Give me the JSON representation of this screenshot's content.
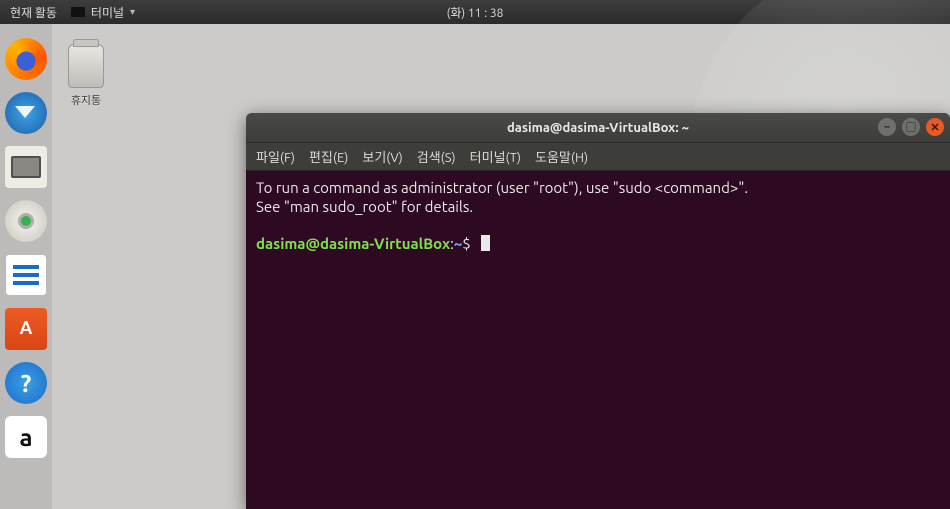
{
  "top_panel": {
    "activities": "현재 활동",
    "app_name": "터미널",
    "clock": "(화) 11 : 38"
  },
  "desktop": {
    "trash_label": "휴지통"
  },
  "terminal": {
    "title": "dasima@dasima-VirtualBox: ~",
    "menu": {
      "file": "파일(F)",
      "edit": "편집(E)",
      "view": "보기(V)",
      "search": "검색(S)",
      "terminal": "터미널(T)",
      "help": "도움말(H)"
    },
    "message_line1": "To run a command as administrator (user \"root\"), use \"sudo <command>\".",
    "message_line2": "See \"man sudo_root\" for details.",
    "ps1_user": "dasima@dasima-VirtualBox",
    "ps1_sep": ":",
    "ps1_path": "~",
    "ps1_end": "$"
  }
}
